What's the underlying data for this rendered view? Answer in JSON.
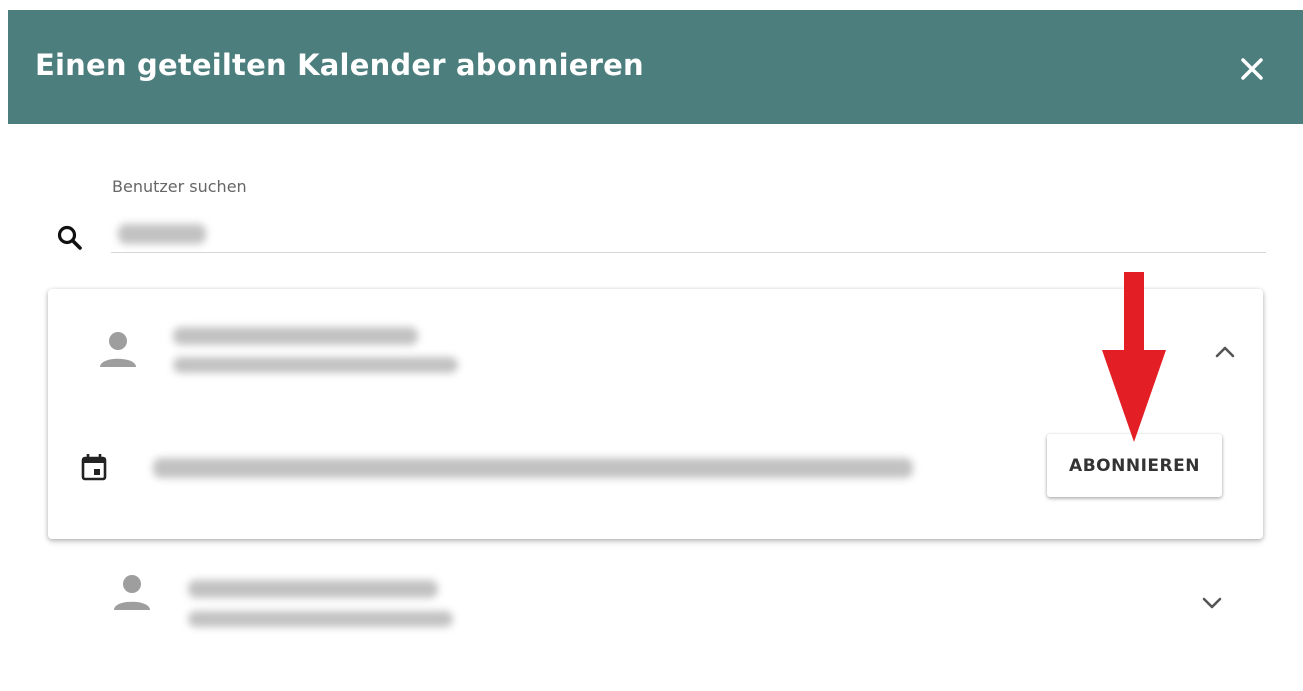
{
  "dialog": {
    "title": "Einen geteilten Kalender abonnieren",
    "close_icon": "close-icon",
    "header_color": "#4d7e7e"
  },
  "search": {
    "label": "Benutzer suchen",
    "value": "",
    "icon": "search-icon"
  },
  "results": [
    {
      "expanded": true,
      "icon": "person-icon",
      "toggle_icon": "chevron-up-icon",
      "calendar": {
        "icon": "calendar-icon",
        "subscribe_label": "ABONNIEREN"
      }
    },
    {
      "expanded": false,
      "icon": "person-icon",
      "toggle_icon": "chevron-down-icon"
    }
  ],
  "annotation": {
    "arrow_color": "#e31e24",
    "icon": "arrow-down-icon"
  }
}
